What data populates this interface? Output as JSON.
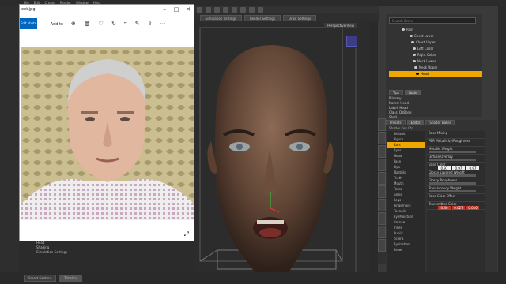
{
  "photos": {
    "title": "ent.jpg",
    "edit_label": "Edit photo",
    "add_label": "Add to",
    "icons": [
      "zoom-in-icon",
      "delete-icon",
      "heart-icon",
      "rotate-icon",
      "crop-icon",
      "edit-icon",
      "share-icon",
      "more-icon"
    ],
    "minimize": "–",
    "maximize": "□",
    "close": "✕",
    "expand": "⤢"
  },
  "daz": {
    "menu": [
      "File",
      "Edit",
      "Create",
      "Render",
      "Window",
      "Help"
    ],
    "top_tabs": [
      "Simulation Settings",
      "Render Settings",
      "Draw Settings"
    ],
    "viewport_title": "Perspective View",
    "scene_search": "Search Scene",
    "scene_rows": [
      "Root",
      "Chest Lower",
      "Chest Upper",
      "Left Collar",
      "Right Collar",
      "Neck Lower",
      "Neck Upper",
      "Head"
    ],
    "scene_tabs": [
      "Tips",
      "Node"
    ],
    "scene_info": [
      "Primary",
      "Name: Head",
      "Label: Head",
      "Class: DzBone",
      "Shell",
      "Name: GenesisMale"
    ],
    "surface_tabs": [
      "Presets",
      "Editor",
      "Shader Baker"
    ],
    "surface_sub": "Shader   Key   Ctrl",
    "surface_list": [
      "Default",
      "Figure",
      "Ears",
      "Eyes",
      "Head",
      "Face",
      "Lips",
      "Nostrils",
      "Teeth",
      "Mouth",
      "Torso",
      "Arms",
      "Legs",
      "Fingernails",
      "Toenails",
      "EyeMoisture",
      "Cornea",
      "Irises",
      "Pupils",
      "Sclera",
      "Eyelashes",
      "Brow"
    ],
    "surface_selected": "Ears",
    "properties": [
      "Base Mixing",
      "PBR Metallicity/Roughness",
      "Metallic Weight",
      "Diffuse Overlay",
      "Base Color",
      "Glossy Layered Weight",
      "Glossy Roughness",
      "Translucency Weight",
      "Base Color Effect",
      "Transmitted Color"
    ],
    "base_color": [
      "0.97",
      "0.97",
      "0.97"
    ],
    "transmitted_color": [
      "0.36",
      "0.027",
      "0.016"
    ],
    "bottom_tabs": [
      "Smart Content",
      "Timeline"
    ],
    "left_tree": [
      "Head",
      "Shading",
      "Simulation Settings"
    ]
  }
}
